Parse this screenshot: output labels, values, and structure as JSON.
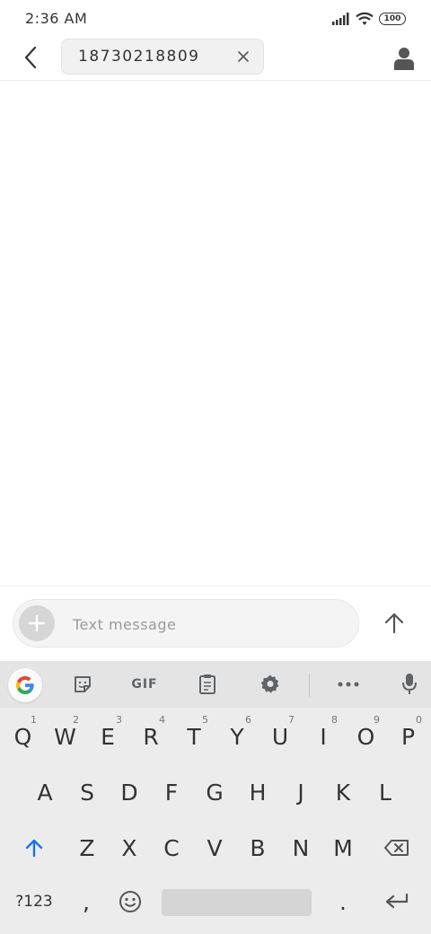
{
  "status_bar": {
    "time": "2:36 AM",
    "battery": "100"
  },
  "header": {
    "recipient": "18730218809"
  },
  "compose": {
    "placeholder": "Text message"
  },
  "keyboard": {
    "toolbar": {
      "gif_label": "GIF"
    },
    "row1": [
      {
        "label": "Q",
        "hint": "1"
      },
      {
        "label": "W",
        "hint": "2"
      },
      {
        "label": "E",
        "hint": "3"
      },
      {
        "label": "R",
        "hint": "4"
      },
      {
        "label": "T",
        "hint": "5"
      },
      {
        "label": "Y",
        "hint": "6"
      },
      {
        "label": "U",
        "hint": "7"
      },
      {
        "label": "I",
        "hint": "8"
      },
      {
        "label": "O",
        "hint": "9"
      },
      {
        "label": "P",
        "hint": "0"
      }
    ],
    "row2": [
      "A",
      "S",
      "D",
      "F",
      "G",
      "H",
      "J",
      "K",
      "L"
    ],
    "row3": [
      "Z",
      "X",
      "C",
      "V",
      "B",
      "N",
      "M"
    ],
    "row4": {
      "symbols": "?123",
      "comma": ",",
      "period": "."
    }
  },
  "colors": {
    "accent_blue": "#1a73e8",
    "icon_gray": "#5f6368"
  }
}
